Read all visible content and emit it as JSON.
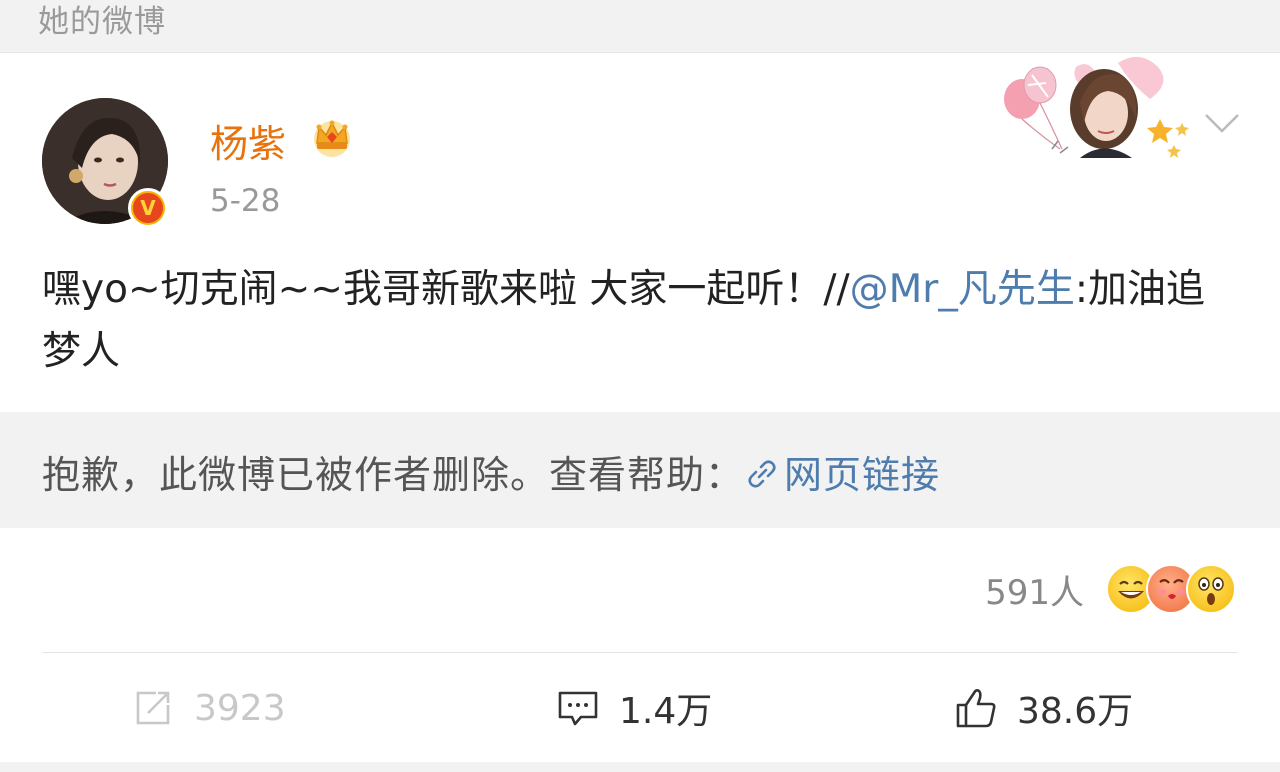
{
  "header": {
    "title": "她的微博"
  },
  "post": {
    "username": "杨紫",
    "time": "5-28",
    "text_before": "嘿yo~切克闹~~我哥新歌来啦 大家一起听！//",
    "mention": "@Mr_凡先生",
    "text_after": ":加油追梦人",
    "verified_badge": "V",
    "icons": {
      "crown": "crown-icon",
      "verified": "verified-v-badge",
      "expand": "chevron-down-icon"
    }
  },
  "deleted_notice": {
    "message": "抱歉，此微博已被作者删除。查看帮助：",
    "link_label": "网页链接",
    "link_icon": "link-icon"
  },
  "reactions": {
    "count": "591人",
    "emoji": [
      "laughing-emoji",
      "kiss-emoji",
      "surprised-emoji"
    ]
  },
  "actions": {
    "repost": {
      "icon": "repost-icon",
      "count": "3923"
    },
    "comment": {
      "icon": "comment-icon",
      "count": "1.4万"
    },
    "like": {
      "icon": "thumbs-up-icon",
      "count": "38.6万"
    }
  },
  "colors": {
    "username": "#e8730c",
    "link": "#4e7cad",
    "muted": "#999999",
    "background_gray": "#f2f2f2"
  }
}
